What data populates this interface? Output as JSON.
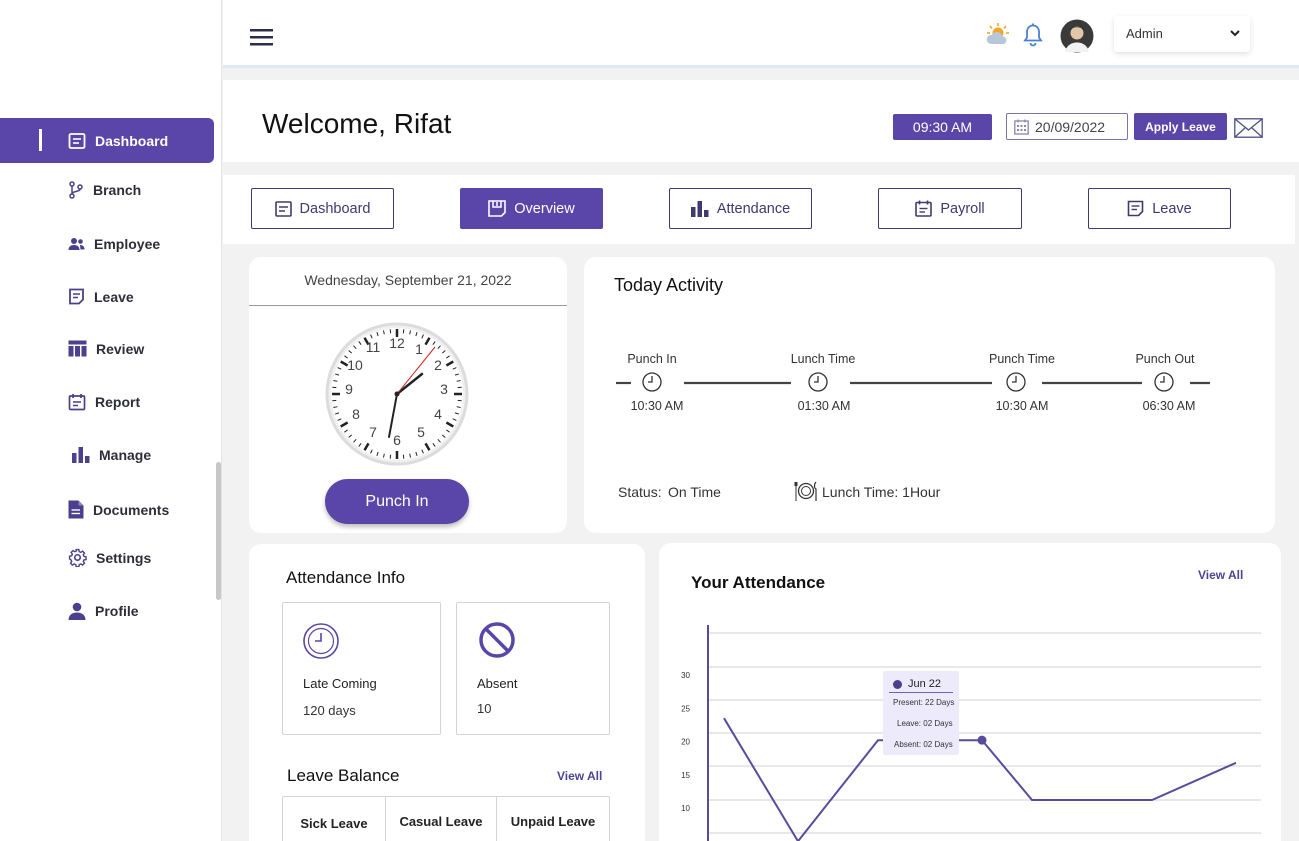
{
  "sidebar": {
    "items": [
      {
        "label": "Dashboard",
        "icon": "dashboard-icon"
      },
      {
        "label": "Branch",
        "icon": "branch-icon"
      },
      {
        "label": "Employee",
        "icon": "employee-icon"
      },
      {
        "label": "Leave",
        "icon": "leave-icon"
      },
      {
        "label": "Review",
        "icon": "review-icon"
      },
      {
        "label": "Report",
        "icon": "report-icon"
      },
      {
        "label": "Manage",
        "icon": "manage-icon"
      },
      {
        "label": "Documents",
        "icon": "documents-icon"
      },
      {
        "label": "Settings",
        "icon": "settings-icon"
      },
      {
        "label": "Profile",
        "icon": "profile-icon"
      }
    ],
    "active_index": 0
  },
  "header": {
    "user_label": "Admin"
  },
  "welcome": {
    "title": "Welcome, Rifat",
    "time": "09:30 AM",
    "date": "20/09/2022",
    "apply_label": "Apply Leave"
  },
  "tabs": [
    {
      "label": "Dashboard"
    },
    {
      "label": "Overview"
    },
    {
      "label": "Attendance"
    },
    {
      "label": "Payroll"
    },
    {
      "label": "Leave"
    }
  ],
  "active_tab": 1,
  "clock_card": {
    "date_text": "Wednesday, September 21, 2022",
    "numbers": [
      "12",
      "1",
      "2",
      "3",
      "4",
      "5",
      "6",
      "7",
      "8",
      "9",
      "10",
      "11"
    ],
    "punch_label": "Punch In"
  },
  "today_activity": {
    "title": "Today Activity",
    "steps": [
      {
        "label": "Punch In",
        "time": "10:30 AM"
      },
      {
        "label": "Lunch Time",
        "time": "01:30 AM"
      },
      {
        "label": "Punch Time",
        "time": "10:30 AM"
      },
      {
        "label": "Punch Out",
        "time": "06:30 AM"
      }
    ],
    "status_label": "Status:",
    "status_value": "On Time",
    "lunch_text": "Lunch Time: 1Hour"
  },
  "attendance_info": {
    "title": "Attendance Info",
    "late_label": "Late Coming",
    "late_value": "120 days",
    "absent_label": "Absent",
    "absent_value": "10"
  },
  "leave_balance": {
    "title": "Leave Balance",
    "view_all": "View All",
    "columns": [
      "Sick Leave",
      "Casual Leave",
      "Unpaid Leave"
    ]
  },
  "your_attendance": {
    "title": "Your Attendance",
    "view_all": "View All",
    "tooltip": {
      "title": "Jun 22",
      "present": "Present: 22 Days",
      "leave": "Leave: 02 Days",
      "absent": "Absent: 02 Days"
    }
  },
  "chart_data": {
    "type": "line",
    "yticks": [
      10,
      15,
      20,
      25,
      30
    ],
    "series": [
      {
        "values": [
          23.5,
          5,
          20.2,
          20.2,
          20.2,
          20.2,
          11.2,
          11.2,
          16.8
        ]
      }
    ],
    "colors": {
      "line": "#5a4a9e",
      "accent": "#5a45a8"
    }
  },
  "colors": {
    "accent": "#5a45a8",
    "outline": "#3e3a70"
  }
}
